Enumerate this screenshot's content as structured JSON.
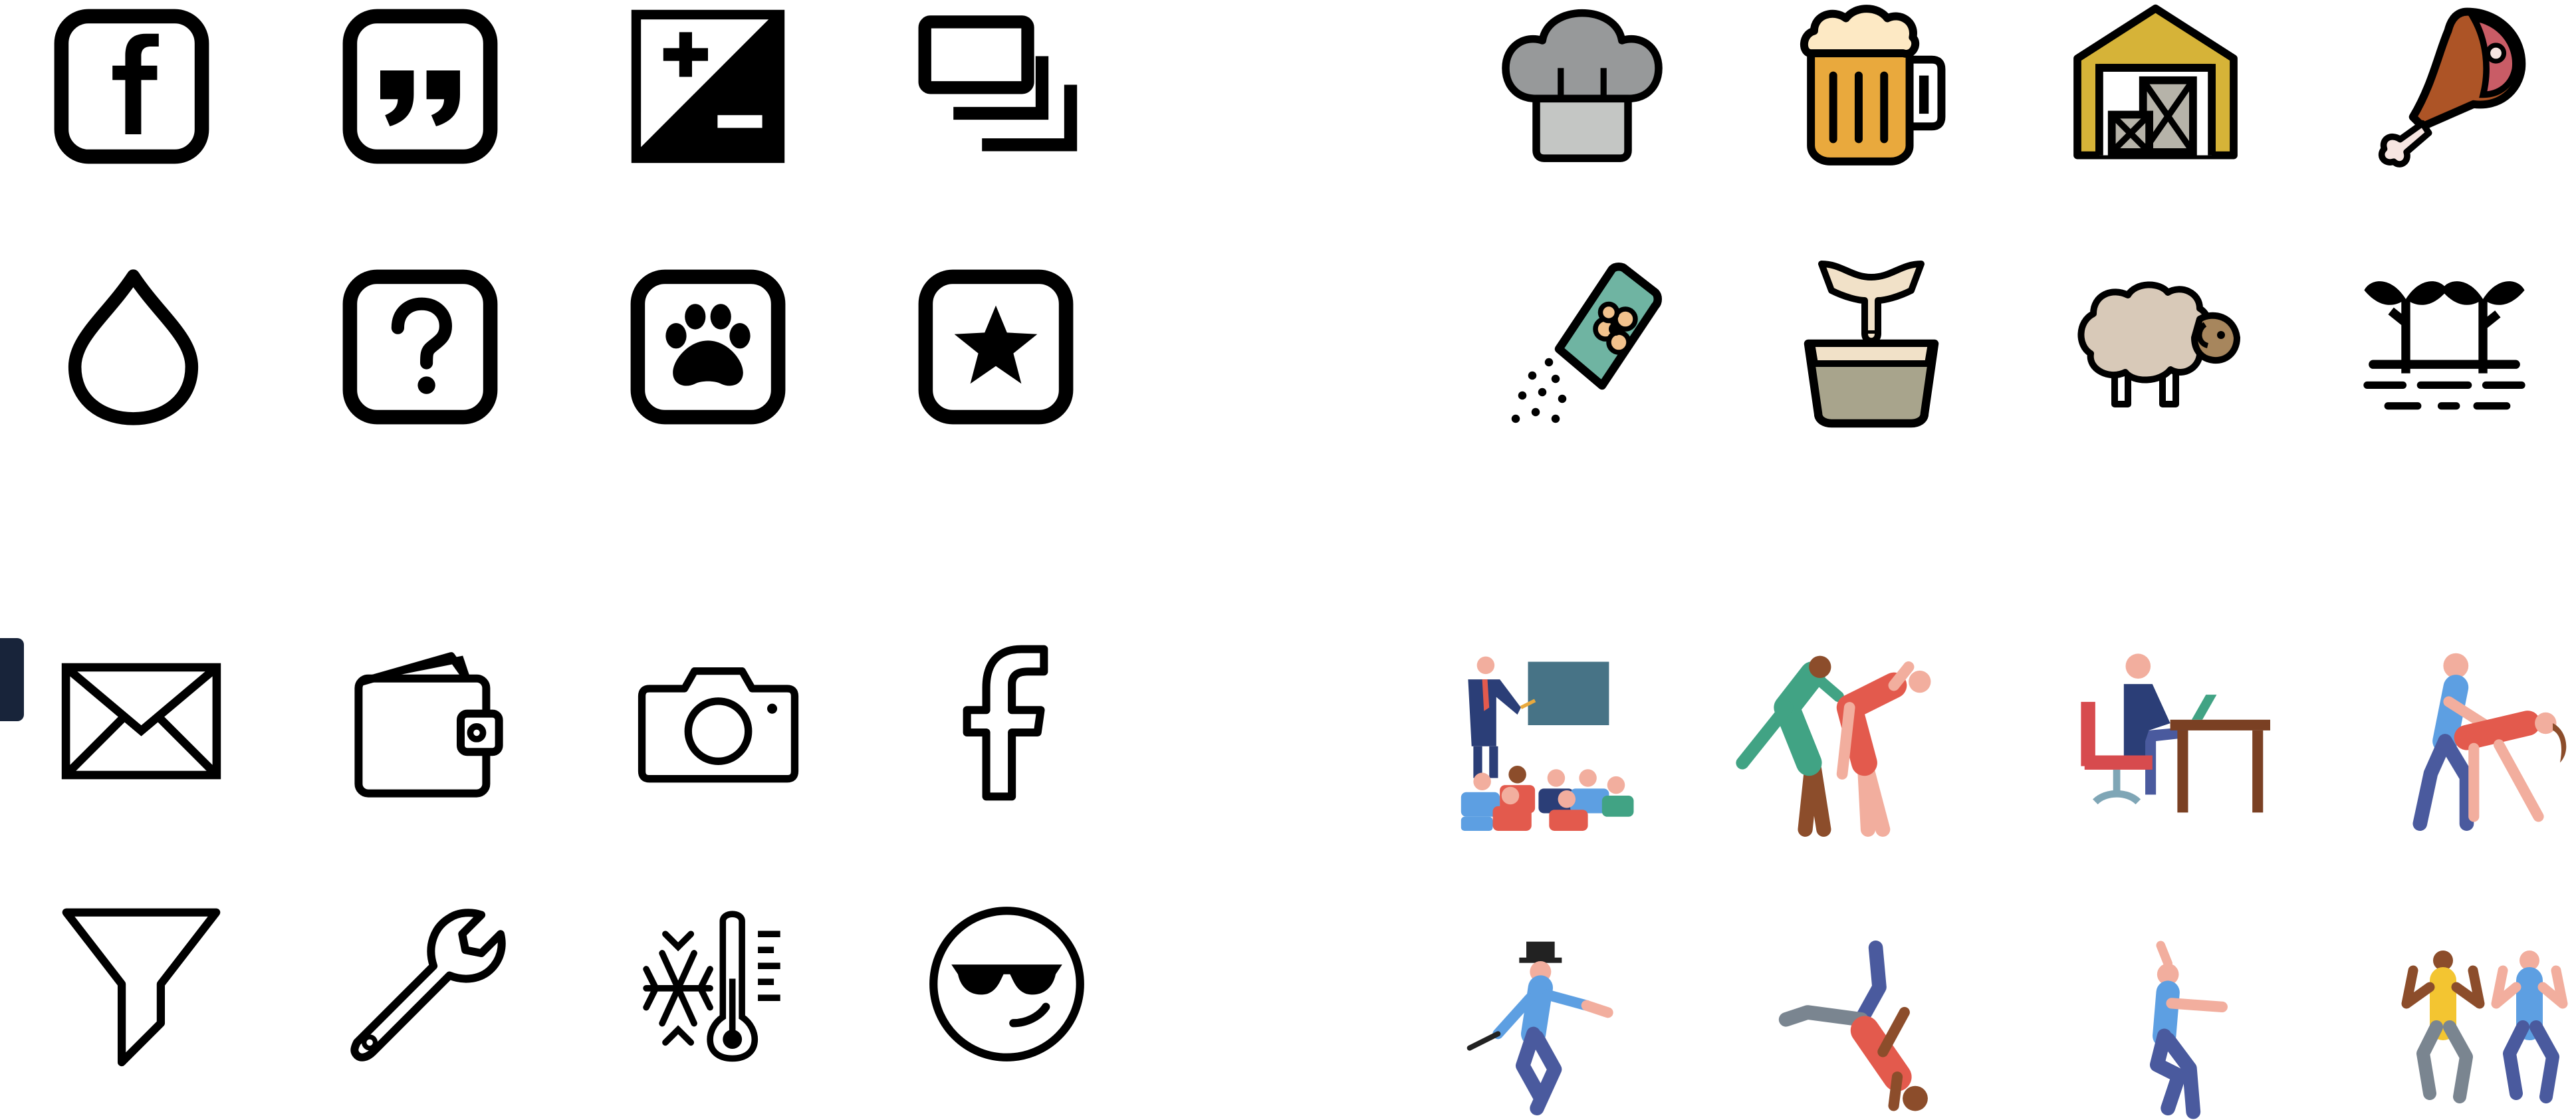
{
  "quadrants": {
    "square_glyphs": [
      "facebook-square-icon",
      "quote-square-icon",
      "exposure-plus-minus-icon",
      "stacked-frames-icon",
      "water-drop-icon",
      "help-square-icon",
      "paw-square-icon",
      "star-square-icon"
    ],
    "farm_filled": [
      "chef-hat-icon",
      "beer-mug-icon",
      "barn-icon",
      "ham-leg-icon",
      "seed-bag-icon",
      "milk-bucket-icon",
      "sheep-icon",
      "sprouts-icon"
    ],
    "outline_glyphs": [
      "envelope-icon",
      "wallet-icon",
      "camera-icon",
      "facebook-f-icon",
      "funnel-icon",
      "wrench-icon",
      "cold-thermometer-icon",
      "cool-face-icon"
    ],
    "people_pictograms": [
      "teacher-class-icon",
      "stretching-pair-icon",
      "office-desk-icon",
      "massage-icon",
      "tap-dancer-icon",
      "breakdancer-icon",
      "dancer-icon",
      "dancing-pair-icon"
    ]
  },
  "colors": {
    "ink": "#000000",
    "chef_hat_top": "#97999a",
    "chef_hat_band": "#c4c6c4",
    "beer": "#e9a93d",
    "beer_foam": "#fde9c4",
    "barn_roof": "#d6b338",
    "barn_crate": "#b6b3a9",
    "ham": "#ad5426",
    "ham_cut": "#c95c66",
    "seed_bag": "#6fb4a2",
    "seed_flower": "#f2c28d",
    "milk_bucket": "#a8a48c",
    "milk": "#f1e1c8",
    "sheep_wool": "#d8c9b8",
    "sheep_head": "#a7865d",
    "skin": "#f2ae9e",
    "blue_shirt": "#5d9fe2",
    "red_shirt": "#e35a4d",
    "teal_shirt": "#41a384",
    "navy": "#2b3e77",
    "denim": "#4a5a9e",
    "brown_table": "#7a4023",
    "board": "#477386",
    "chair_red": "#d74b4e",
    "yellow_shirt": "#f3c531",
    "dark_skin": "#8c4d2b",
    "edge_mark": "#18243a"
  }
}
